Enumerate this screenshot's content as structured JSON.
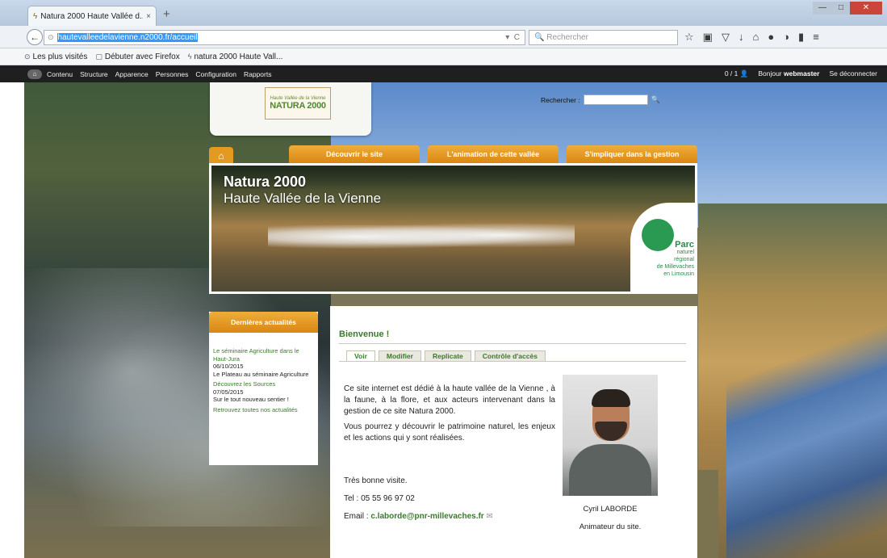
{
  "browser": {
    "tab_title": "Natura 2000 Haute Vallée d...",
    "tab_close": "×",
    "new_tab": "+",
    "url": "hautevalleedelavienne.n2000.fr/accueil",
    "search_placeholder": "Rechercher",
    "reload": "C",
    "win_min": "—",
    "win_max": "□",
    "win_close": "✕",
    "icons": [
      "star-icon",
      "reading-list-icon",
      "pocket-icon",
      "download-icon",
      "home-icon",
      "chat-icon",
      "sync-icon",
      "extension-icon",
      "menu-icon"
    ],
    "icon_glyphs": [
      "☆",
      "▣",
      "▽",
      "↓",
      "⌂",
      "●",
      "◑",
      "▮",
      "≡"
    ],
    "bookmarks": [
      {
        "label": "Les plus visités",
        "icon": "⊙"
      },
      {
        "label": "Débuter avec Firefox",
        "icon": "▢"
      },
      {
        "label": "natura 2000 Haute Vall...",
        "icon": "ϟ"
      }
    ]
  },
  "admin": {
    "home": "⌂",
    "items": [
      "Contenu",
      "Structure",
      "Apparence",
      "Personnes",
      "Configuration",
      "Rapports"
    ],
    "counter": "0 / 1",
    "greeting": "Bonjour",
    "user": "webmaster",
    "logout": "Se déconnecter"
  },
  "site": {
    "logo_small": "Haute Vallée de la Vienne",
    "logo_big": "NATURA 2000",
    "search_label": "Rechercher :",
    "nav": [
      "Découvrir le site",
      "L'animation de cette vallée",
      "S'impliquer dans la gestion"
    ],
    "banner_title": "Natura 2000",
    "banner_subtitle": "Haute Vallée de la Vienne",
    "parc": [
      "Parc",
      "naturel",
      "régional",
      "de Millevaches",
      "en Limousin"
    ]
  },
  "news": {
    "title": "Dernières actualités",
    "items": [
      {
        "text": "Le séminaire Agriculture dans le Haut-Jura",
        "kind": "link"
      },
      {
        "text": "06/10/2015",
        "kind": "date"
      },
      {
        "text": "Le Plateau au séminaire Agriculture",
        "kind": "text"
      },
      {
        "text": "Découvrez les Sources",
        "kind": "link"
      },
      {
        "text": "07/05/2015",
        "kind": "date"
      },
      {
        "text": "Sur le tout nouveau sentier !",
        "kind": "text"
      },
      {
        "text": "Retrouvez toutes nos actualités",
        "kind": "link"
      }
    ]
  },
  "content": {
    "title": "Bienvenue !",
    "tabs": [
      "Voir",
      "Modifier",
      "Replicate",
      "Contrôle d'accès"
    ],
    "active_tab": "Voir",
    "paragraphs": [
      "Ce site internet est dédié à la haute vallée de la Vienne , à la faune, à la flore, et aux acteurs intervenant dans la gestion de ce site Natura 2000.",
      "Vous pourrez y découvrir le patrimoine naturel, les enjeux et les actions qui y sont réalisées."
    ],
    "closing": "Très bonne visite.",
    "tel": "Tel : 05 55 96 97 02",
    "email_label": "Email :",
    "email": "c.laborde@pnr-millevaches.fr",
    "person_name": "Cyril LABORDE",
    "person_role": "Animateur du site."
  }
}
